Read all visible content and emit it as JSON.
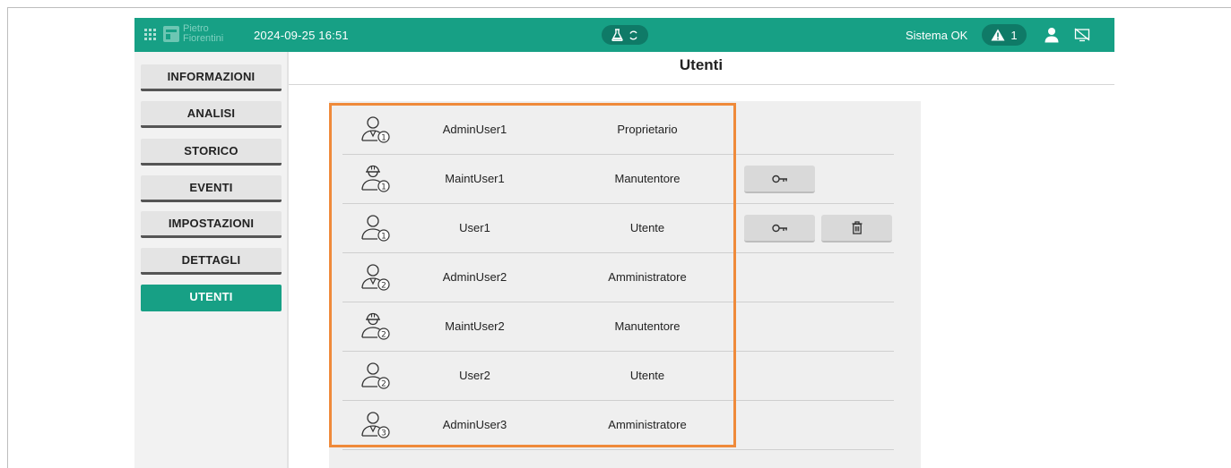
{
  "topbar": {
    "brand_line1": "Pietro",
    "brand_line2": "Fiorentini",
    "datetime": "2024-09-25 16:51",
    "system_status": "Sistema OK",
    "alarm_count": "1",
    "icons": [
      "apps-grid-icon",
      "company-logo-icon",
      "flask-icon",
      "refresh-icon",
      "warning-icon",
      "user-icon",
      "screen-off-icon"
    ]
  },
  "sidebar": {
    "items": [
      {
        "label": "INFORMAZIONI",
        "active": false
      },
      {
        "label": "ANALISI",
        "active": false
      },
      {
        "label": "STORICO",
        "active": false
      },
      {
        "label": "EVENTI",
        "active": false
      },
      {
        "label": "IMPOSTAZIONI",
        "active": false
      },
      {
        "label": "DETTAGLI",
        "active": false
      },
      {
        "label": "UTENTI",
        "active": true
      }
    ]
  },
  "main": {
    "title": "Utenti",
    "users": [
      {
        "name": "AdminUser1",
        "role": "Proprietario",
        "icon": "admin-user-1-icon",
        "actions": []
      },
      {
        "name": "MaintUser1",
        "role": "Manutentore",
        "icon": "maintainer-user-1-icon",
        "actions": [
          "key"
        ]
      },
      {
        "name": "User1",
        "role": "Utente",
        "icon": "user-1-icon",
        "actions": [
          "key",
          "delete"
        ]
      },
      {
        "name": "AdminUser2",
        "role": "Amministratore",
        "icon": "admin-user-2-icon",
        "actions": []
      },
      {
        "name": "MaintUser2",
        "role": "Manutentore",
        "icon": "maintainer-user-2-icon",
        "actions": []
      },
      {
        "name": "User2",
        "role": "Utente",
        "icon": "user-2-icon",
        "actions": []
      },
      {
        "name": "AdminUser3",
        "role": "Amministratore",
        "icon": "admin-user-3-icon",
        "actions": []
      }
    ]
  },
  "colors": {
    "brand_teal": "#17a085",
    "dark_teal": "#0f7a67",
    "highlight_orange": "#ef8a3a"
  }
}
